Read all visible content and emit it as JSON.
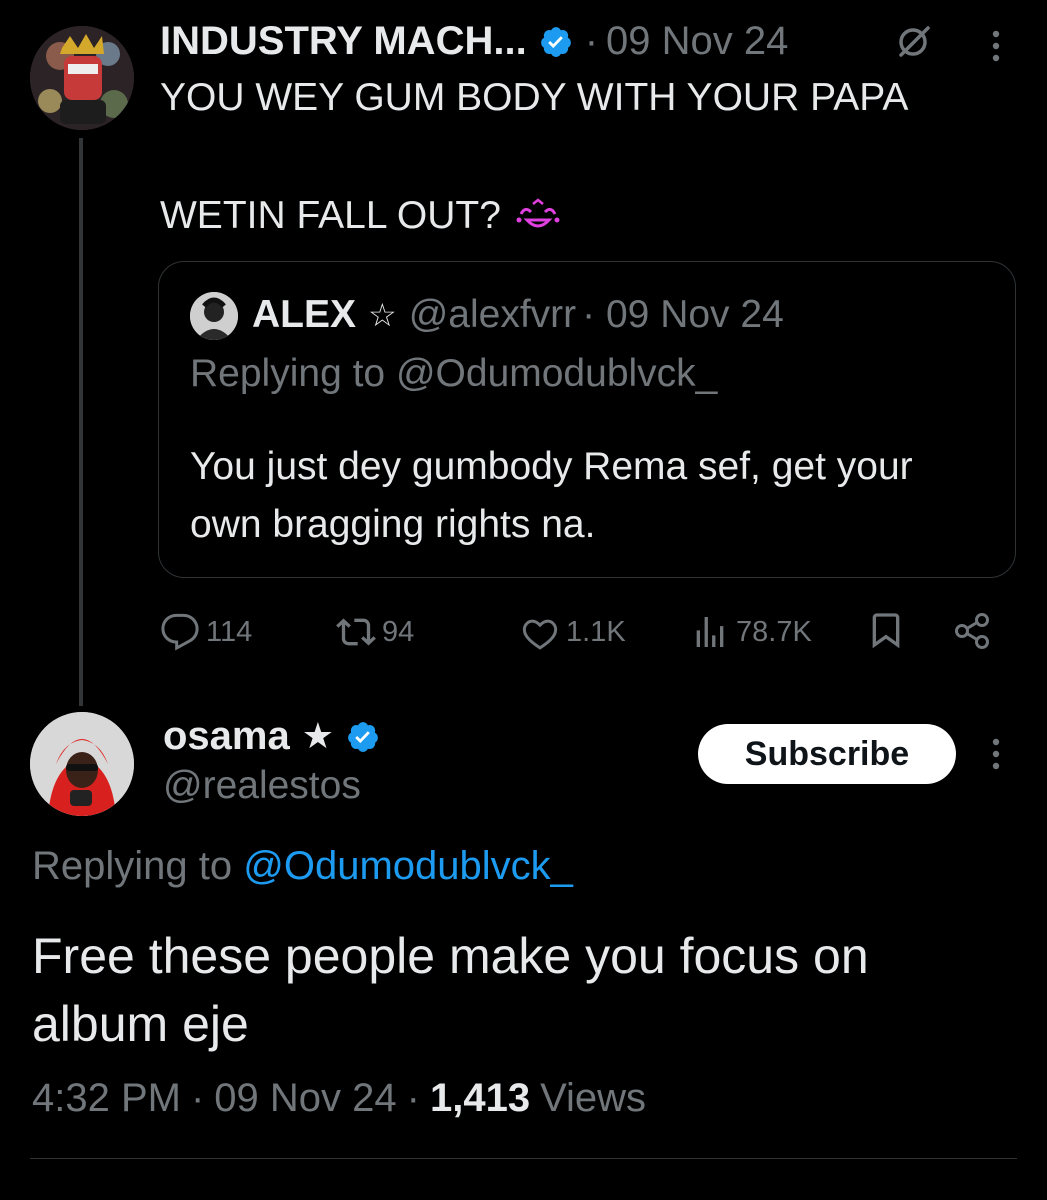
{
  "parent_tweet": {
    "author_name": "INDUSTRY MACH...",
    "date_sep": "·",
    "date": "09 Nov 24",
    "text_line1": "YOU WEY GUM BODY WITH YOUR PAPA",
    "text_line2": "WETIN FALL OUT?",
    "emoji": "😹",
    "quoted": {
      "author_name": "ALEX",
      "star": "☆",
      "handle": "@alexfvrr",
      "date": "· 09 Nov 24",
      "replying_to": "Replying to @Odumodublvck_",
      "text": "You just dey gumbody Rema sef, get your own bragging rights na."
    },
    "actions": {
      "replies": "114",
      "reposts": "94",
      "likes": "1.1K",
      "views": "78.7K"
    }
  },
  "main_tweet": {
    "author_name": "osama",
    "star": "★",
    "handle": "@realestos",
    "subscribe_label": "Subscribe",
    "replying_prefix": "Replying to",
    "replying_handle": "@Odumodublvck_",
    "text": "Free these people make you focus on album eje",
    "time": "4:32 PM",
    "sep1": "·",
    "date": "09 Nov 24",
    "sep2": "·",
    "views_count": "1,413",
    "views_label": "Views"
  },
  "colors": {
    "background": "#000000",
    "text": "#e7e9ea",
    "muted": "#71767b",
    "link": "#1d9bf0",
    "verified": "#1d9bf0"
  },
  "icons": [
    "verified-badge-icon",
    "grok-icon",
    "more-icon",
    "reply-icon",
    "repost-icon",
    "like-icon",
    "views-icon",
    "bookmark-icon",
    "share-icon"
  ]
}
